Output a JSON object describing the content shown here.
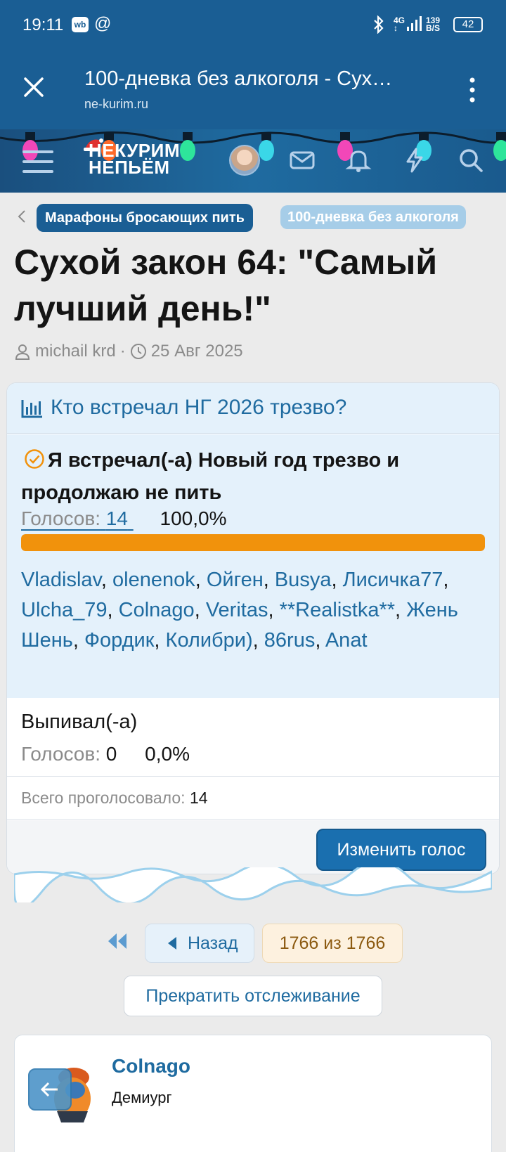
{
  "status_bar": {
    "time": "19:11",
    "wb_badge": "wb",
    "at_sign": "@",
    "network": "4G",
    "data_rate_value": "139",
    "data_rate_unit": "B/S",
    "battery": "42"
  },
  "browser": {
    "title": "100-дневка без алкоголя - Сух…",
    "url": "ne-kurim.ru"
  },
  "site_header": {
    "logo_line1": "НЕКУРИМ",
    "logo_line2": "НЕПЬЁМ"
  },
  "breadcrumbs": [
    "Марафоны бросающих пить",
    "100-дневка без алкоголя"
  ],
  "thread": {
    "title": "Сухой закон 64: \"Самый лучший день!\"",
    "author": "michail krd",
    "separator": "·",
    "date": "25 Авг 2025"
  },
  "poll": {
    "question": "Кто встречал НГ 2026 трезво?",
    "options": [
      {
        "label": "Я встречал(-а) Новый год трезво и продолжаю не пить",
        "votes_label": "Голосов:",
        "votes": "14",
        "percent_text": "100,0%",
        "percent": 100,
        "voters": [
          "Vladislav",
          "olenenok",
          "Ойген",
          "Busya",
          "Лисичка77",
          "Ulcha_79",
          "Colnago",
          "Veritas",
          "**Realistka**",
          "Жень Шень",
          "Фордик",
          "Колибри)",
          "86rus",
          "Anat"
        ]
      },
      {
        "label": "Выпивал(-а)",
        "votes_label": "Голосов:",
        "votes": "0",
        "percent_text": "0,0%",
        "percent": 0
      }
    ],
    "total_label": "Всего проголосовало:",
    "total": "14",
    "change_vote": "Изменить голос"
  },
  "pagination": {
    "prev": "Назад",
    "indicator": "1766 из 1766"
  },
  "unwatch": "Прекратить отслеживание",
  "post": {
    "author": "Colnago",
    "role": "Демиург"
  },
  "colors": {
    "brand": "#1a5e94",
    "link": "#1f6ba0",
    "poll_bar": "#f1920c",
    "poll_bg": "#e4f1fb"
  },
  "icons": [
    "close-icon",
    "more-vert-icon",
    "menu-icon",
    "mail-icon",
    "bell-icon",
    "lightning-icon",
    "search-icon",
    "chevron-left-icon",
    "user-icon",
    "clock-icon",
    "bar-chart-icon",
    "check-circle-icon",
    "double-arrow-left-icon",
    "triangle-left-icon",
    "arrow-left-icon"
  ]
}
